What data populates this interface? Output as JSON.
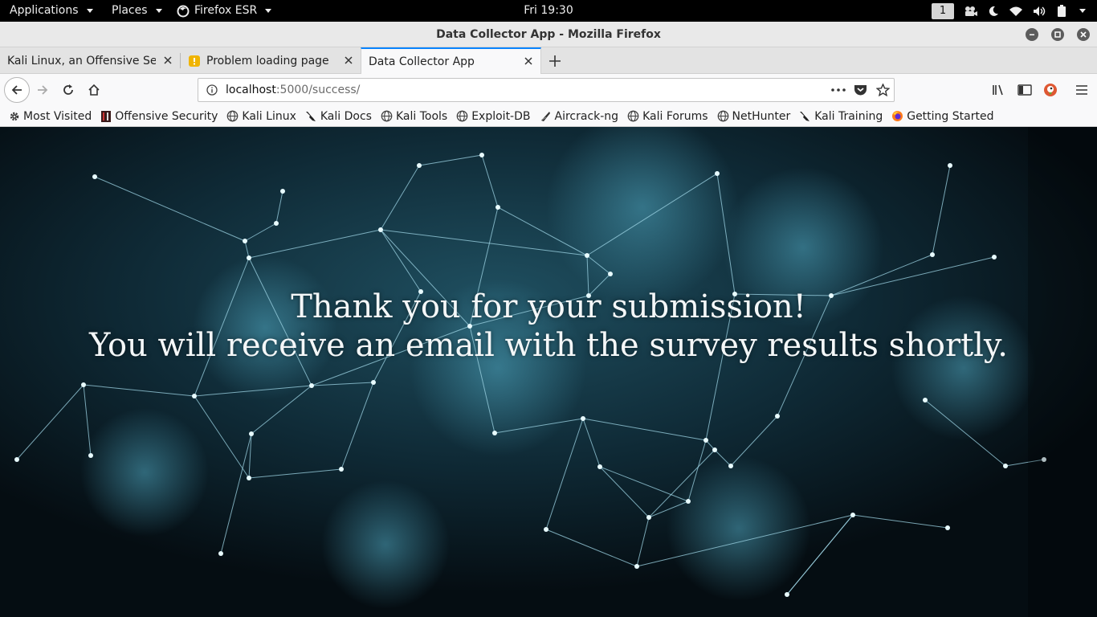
{
  "system_bar": {
    "applications": "Applications",
    "places": "Places",
    "browser_menu": "Firefox ESR",
    "clock": "Fri 19:30",
    "workspace": "1"
  },
  "window": {
    "title": "Data Collector App - Mozilla Firefox"
  },
  "tabs": [
    {
      "label": "Kali Linux, an Offensive Security"
    },
    {
      "label": "Problem loading page"
    },
    {
      "label": "Data Collector App"
    }
  ],
  "urlbar": {
    "host": "localhost",
    "path": ":5000/success/"
  },
  "bookmarks": [
    {
      "label": "Most Visited",
      "icon": "gear-icon"
    },
    {
      "label": "Offensive Security",
      "icon": "offsec-icon"
    },
    {
      "label": "Kali Linux",
      "icon": "globe-icon"
    },
    {
      "label": "Kali Docs",
      "icon": "kali-dragon-icon"
    },
    {
      "label": "Kali Tools",
      "icon": "globe-icon"
    },
    {
      "label": "Exploit-DB",
      "icon": "globe-icon"
    },
    {
      "label": "Aircrack-ng",
      "icon": "aircrack-icon"
    },
    {
      "label": "Kali Forums",
      "icon": "globe-icon"
    },
    {
      "label": "NetHunter",
      "icon": "globe-icon"
    },
    {
      "label": "Kali Training",
      "icon": "kali-dragon-icon"
    },
    {
      "label": "Getting Started",
      "icon": "firefox-icon"
    }
  ],
  "page": {
    "line1": "Thank you for your submission!",
    "line2": "You will receive an email with the survey results shortly."
  },
  "colors": {
    "tab_accent": "#0a84ff",
    "background": "#0b1a22",
    "network_lines": "#9fd6e6"
  }
}
